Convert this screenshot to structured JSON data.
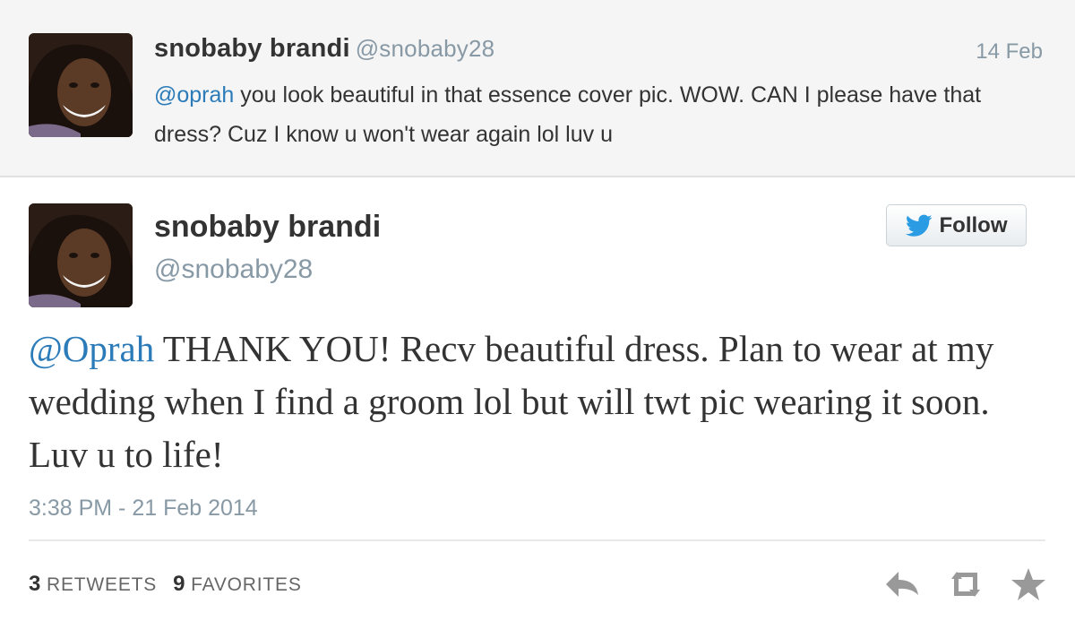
{
  "reply_tweet": {
    "name": "snobaby brandi",
    "handle": "@snobaby28",
    "date": "14 Feb",
    "mention": "@oprah",
    "text": " you look beautiful in that essence cover pic. WOW. CAN I please have that dress?  Cuz I know u won't wear again lol luv u"
  },
  "main_tweet": {
    "name": "snobaby brandi",
    "handle": "@snobaby28",
    "follow_label": "Follow",
    "mention": "@Oprah",
    "text": " THANK YOU! Recv beautiful dress. Plan to wear at my wedding when I find a groom lol but will twt pic wearing it soon. Luv u to life!",
    "timestamp": "3:38 PM - 21 Feb 2014",
    "retweets_count": "3",
    "retweets_label": "RETWEETS",
    "favorites_count": "9",
    "favorites_label": "FAVORITES"
  },
  "icons": {
    "follow": "twitter-bird-icon",
    "reply": "reply-icon",
    "retweet": "retweet-icon",
    "favorite": "star-icon"
  },
  "colors": {
    "link": "#2b7bb9",
    "muted": "#8899a6",
    "action_icon": "#999999"
  }
}
